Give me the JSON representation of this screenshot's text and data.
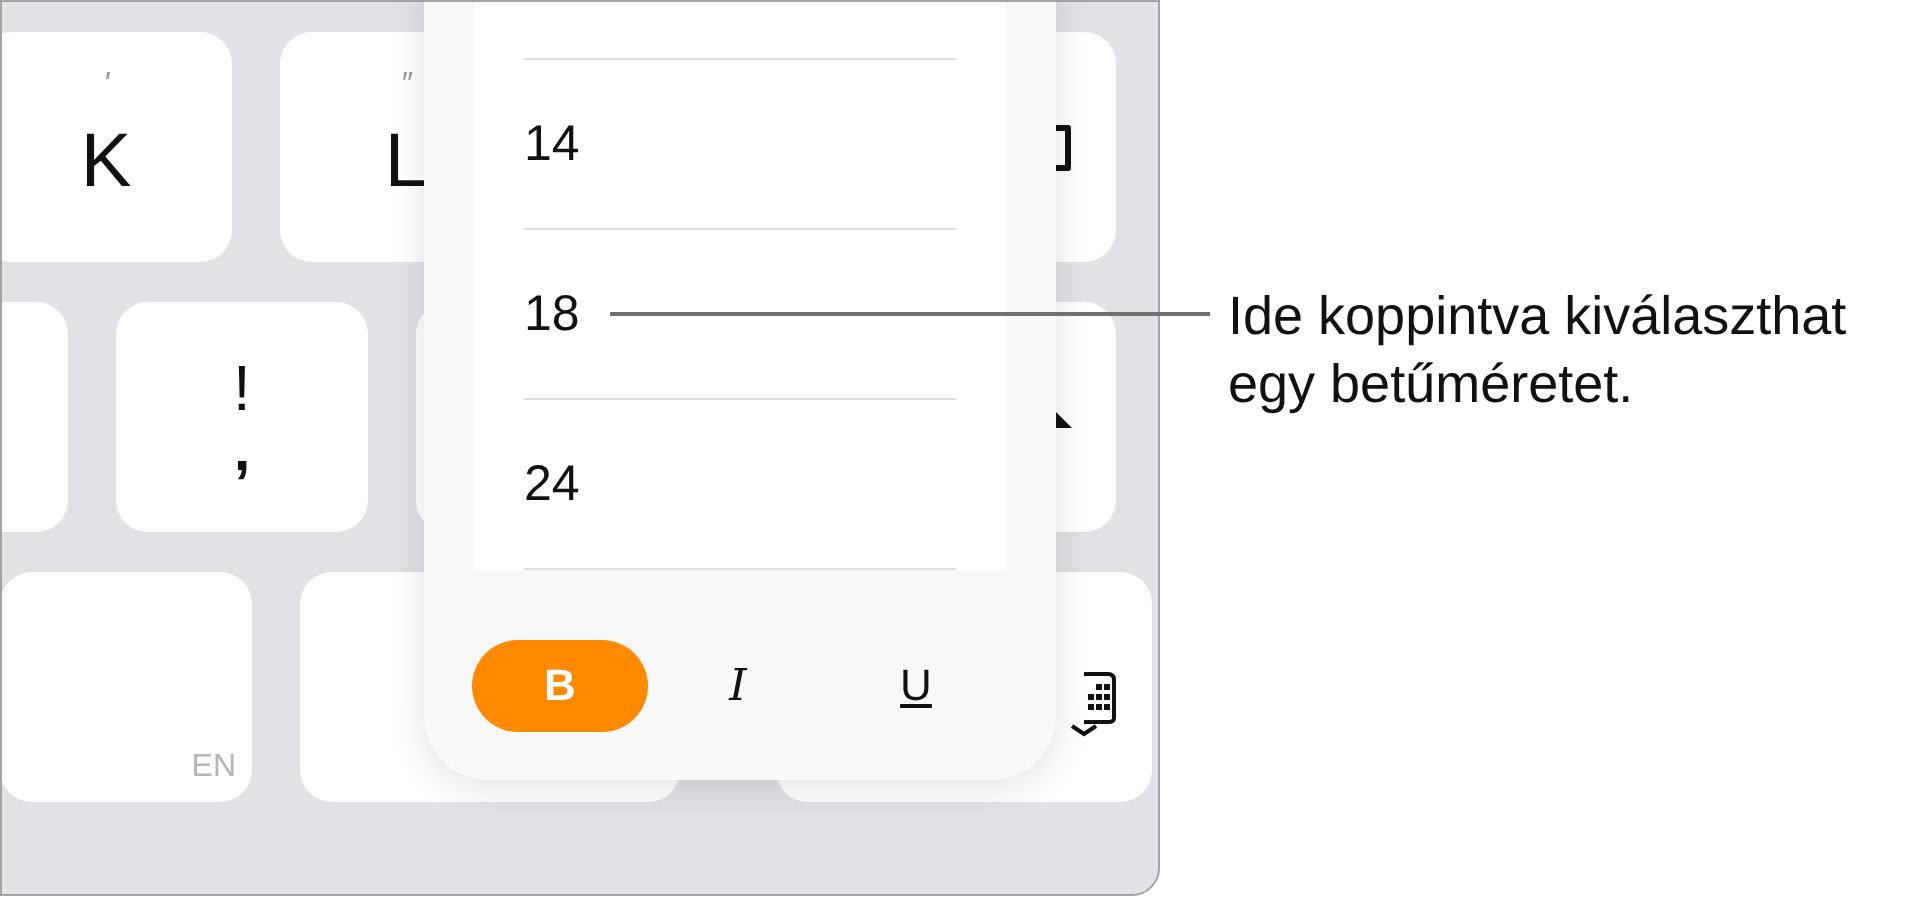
{
  "keyboard": {
    "row_1": [
      {
        "label": "K",
        "hint": "'"
      },
      {
        "label": "L",
        "hint": "″"
      }
    ],
    "row_2": [
      {
        "upper": "!",
        "lower": ","
      }
    ],
    "language": "EN"
  },
  "font_size_menu": {
    "sizes": [
      {
        "label": "14"
      },
      {
        "label": "18"
      },
      {
        "label": "24"
      }
    ],
    "styles": [
      {
        "label": "B",
        "kind": "bold",
        "on": true
      },
      {
        "label": "I",
        "kind": "italic",
        "on": false
      },
      {
        "label": "U",
        "kind": "underline",
        "on": false
      }
    ]
  },
  "callout": {
    "text": "Ide koppintva kiválaszthat egy betűméretet."
  }
}
